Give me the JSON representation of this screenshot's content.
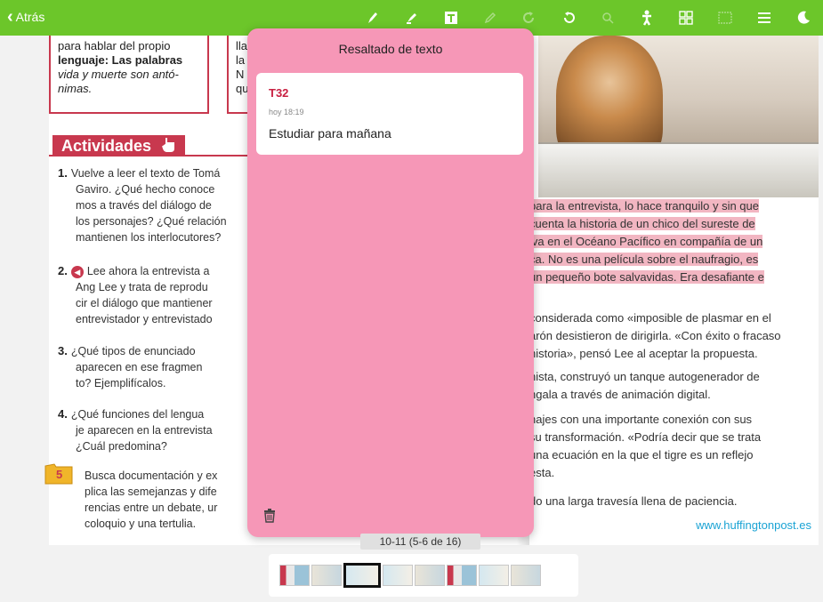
{
  "topbar": {
    "back_label": "Atrás",
    "tools": [
      {
        "name": "pen-icon",
        "dim": false
      },
      {
        "name": "highlighter-icon",
        "dim": false
      },
      {
        "name": "text-tool-icon",
        "dim": false
      },
      {
        "name": "pencil-icon",
        "dim": true
      },
      {
        "name": "redo-icon",
        "dim": true
      },
      {
        "name": "undo-icon",
        "dim": false
      },
      {
        "name": "search-icon",
        "dim": true
      },
      {
        "name": "accessibility-icon",
        "dim": false
      },
      {
        "name": "grid-icon",
        "dim": false
      },
      {
        "name": "bookmark-icon",
        "dim": true
      },
      {
        "name": "list-icon",
        "dim": false
      },
      {
        "name": "night-mode-icon",
        "dim": false
      }
    ]
  },
  "left_page": {
    "box1": [
      "para hablar del propio",
      "lenguaje: Las palabras",
      "vida y muerte son antó-",
      "nimas."
    ],
    "box2": [
      "lla",
      "la",
      "N",
      "qu"
    ],
    "activities_title": "Actividades",
    "activities": [
      {
        "num": "1.",
        "lines": [
          "Vuelve a leer el texto de Tomá",
          "Gaviro. ¿Qué hecho conoce",
          "mos a través del diálogo de",
          "los personajes? ¿Qué relación",
          "mantienen los interlocutores?"
        ]
      },
      {
        "num": "2.",
        "lines": [
          "Lee ahora la entrevista a",
          "Ang Lee y trata de reprodu",
          "cir el diálogo que mantiener",
          "entrevistador y entrevistado"
        ]
      },
      {
        "num": "3.",
        "lines": [
          "¿Qué tipos de enunciado",
          "aparecen en ese fragmen",
          "to? Ejemplifícalos."
        ]
      },
      {
        "num": "4.",
        "lines": [
          "¿Qué funciones del lengua",
          "je aparecen en la entrevista",
          "¿Cuál predomina?"
        ]
      },
      {
        "num": "5",
        "lines": [
          "Busca documentación y ex",
          "plica las semejanzas y dife",
          "rencias entre un debate, ur",
          "coloquio y una tertulia."
        ]
      }
    ]
  },
  "right_page": {
    "highlighted": [
      "para la entrevista, lo hace tranquilo y sin que",
      "cuenta la historia de un chico del sureste de",
      "iva en el Océano Pacífico en compañía de un",
      "ca. No es una película sobre el naufragio, es",
      "un pequeño bote salvavidas. Era desafiante e"
    ],
    "paragraphs": [
      [
        "considerada como «imposible de plasmar en el",
        "arón desistieron de dirigirla. «Con éxito o fracaso",
        "historia», pensó Lee al aceptar la propuesta."
      ],
      [
        "nista, construyó un tanque autogenerador de",
        "ngala a través de animación digital."
      ],
      [
        "najes con una importante conexión con sus",
        "su transformación. «Podría decir que se trata",
        "una ecuación en la que el tigre es un reflejo",
        "esta."
      ],
      [
        "do una larga travesía llena de paciencia."
      ]
    ],
    "source": "www.huffingtonpost.es"
  },
  "popup": {
    "title": "Resaltado de texto",
    "note": {
      "code": "T32",
      "time": "hoy 18:19",
      "text": "Estudiar para mañana"
    }
  },
  "footer": {
    "page_label": "10-11 (5-6 de 16)"
  }
}
